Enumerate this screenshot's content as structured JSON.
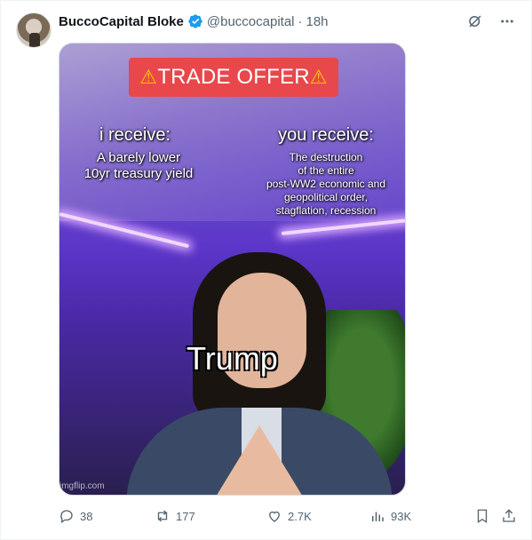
{
  "post": {
    "author_name": "BuccoCapital Bloke",
    "handle": "@buccocapital",
    "separator": "·",
    "time": "18h"
  },
  "meme": {
    "banner": "TRADE OFFER",
    "receive_heading": "i receive:",
    "receive_body_line1": "A barely lower",
    "receive_body_line2": "10yr treasury yield",
    "you_receive_heading": "you receive:",
    "you_receive_line1": "The destruction",
    "you_receive_line2": "of the entire",
    "you_receive_line3": "post-WW2 economic and",
    "you_receive_line4": "geopolitical order,",
    "you_receive_line5": "stagflation, recession",
    "caption": "Trump",
    "watermark": "imgflip.com"
  },
  "actions": {
    "replies": "38",
    "reposts": "177",
    "likes": "2.7K",
    "views": "93K"
  },
  "icons": {
    "verified": "verified-badge-icon",
    "grok": "grok-icon",
    "more": "more-icon",
    "reply": "reply-icon",
    "repost": "repost-icon",
    "like": "heart-icon",
    "views": "views-icon",
    "bookmark": "bookmark-icon",
    "share": "share-icon"
  },
  "colors": {
    "verified_blue": "#1d9bf0",
    "muted": "#536471",
    "banner_red": "#e8474b"
  }
}
